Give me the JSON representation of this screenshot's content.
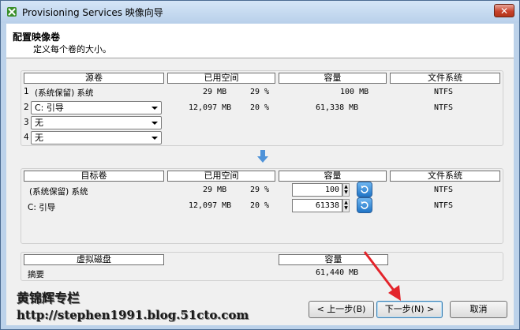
{
  "window": {
    "title": "Provisioning Services 映像向导",
    "close_label": "✕"
  },
  "header": {
    "title": "配置映像卷",
    "subtitle": "定义每个卷的大小。"
  },
  "source_panel": {
    "columns": [
      "源卷",
      "已用空间",
      "容量",
      "文件系统"
    ],
    "rows": [
      {
        "index": "1",
        "volume": "(系统保留)  系统",
        "used": "29 MB",
        "pct": "29 %",
        "capacity": "100 MB",
        "fs": "NTFS"
      },
      {
        "index": "2",
        "volume": "C: 引导",
        "used": "12,097 MB",
        "pct": "20 %",
        "capacity": "61,338 MB",
        "fs": "NTFS"
      },
      {
        "index": "3",
        "volume": "无",
        "used": "",
        "pct": "",
        "capacity": "",
        "fs": ""
      },
      {
        "index": "4",
        "volume": "无",
        "used": "",
        "pct": "",
        "capacity": "",
        "fs": ""
      }
    ]
  },
  "target_panel": {
    "columns": [
      "目标卷",
      "已用空间",
      "容量",
      "文件系统"
    ],
    "rows": [
      {
        "volume": "(系统保留)  系统",
        "used": "29 MB",
        "pct": "29 %",
        "capacity": "100",
        "fs": "NTFS"
      },
      {
        "volume": "C: 引导",
        "used": "12,097 MB",
        "pct": "20 %",
        "capacity": "61338",
        "fs": "NTFS"
      }
    ]
  },
  "vdisk_panel": {
    "columns": [
      "虚拟磁盘",
      "容量"
    ],
    "summary_label": "摘要",
    "summary_capacity": "61,440 MB"
  },
  "watermark": {
    "line1": "黄锦辉专栏",
    "line2": "http://stephen1991.blog.51cto.com"
  },
  "buttons": {
    "back": "< 上一步(B)",
    "next": "下一步(N) >",
    "cancel": "取消"
  },
  "colors": {
    "title_bar": "#bcd2ea",
    "close": "#c8432c",
    "annotation_arrow": "#e3242b"
  }
}
